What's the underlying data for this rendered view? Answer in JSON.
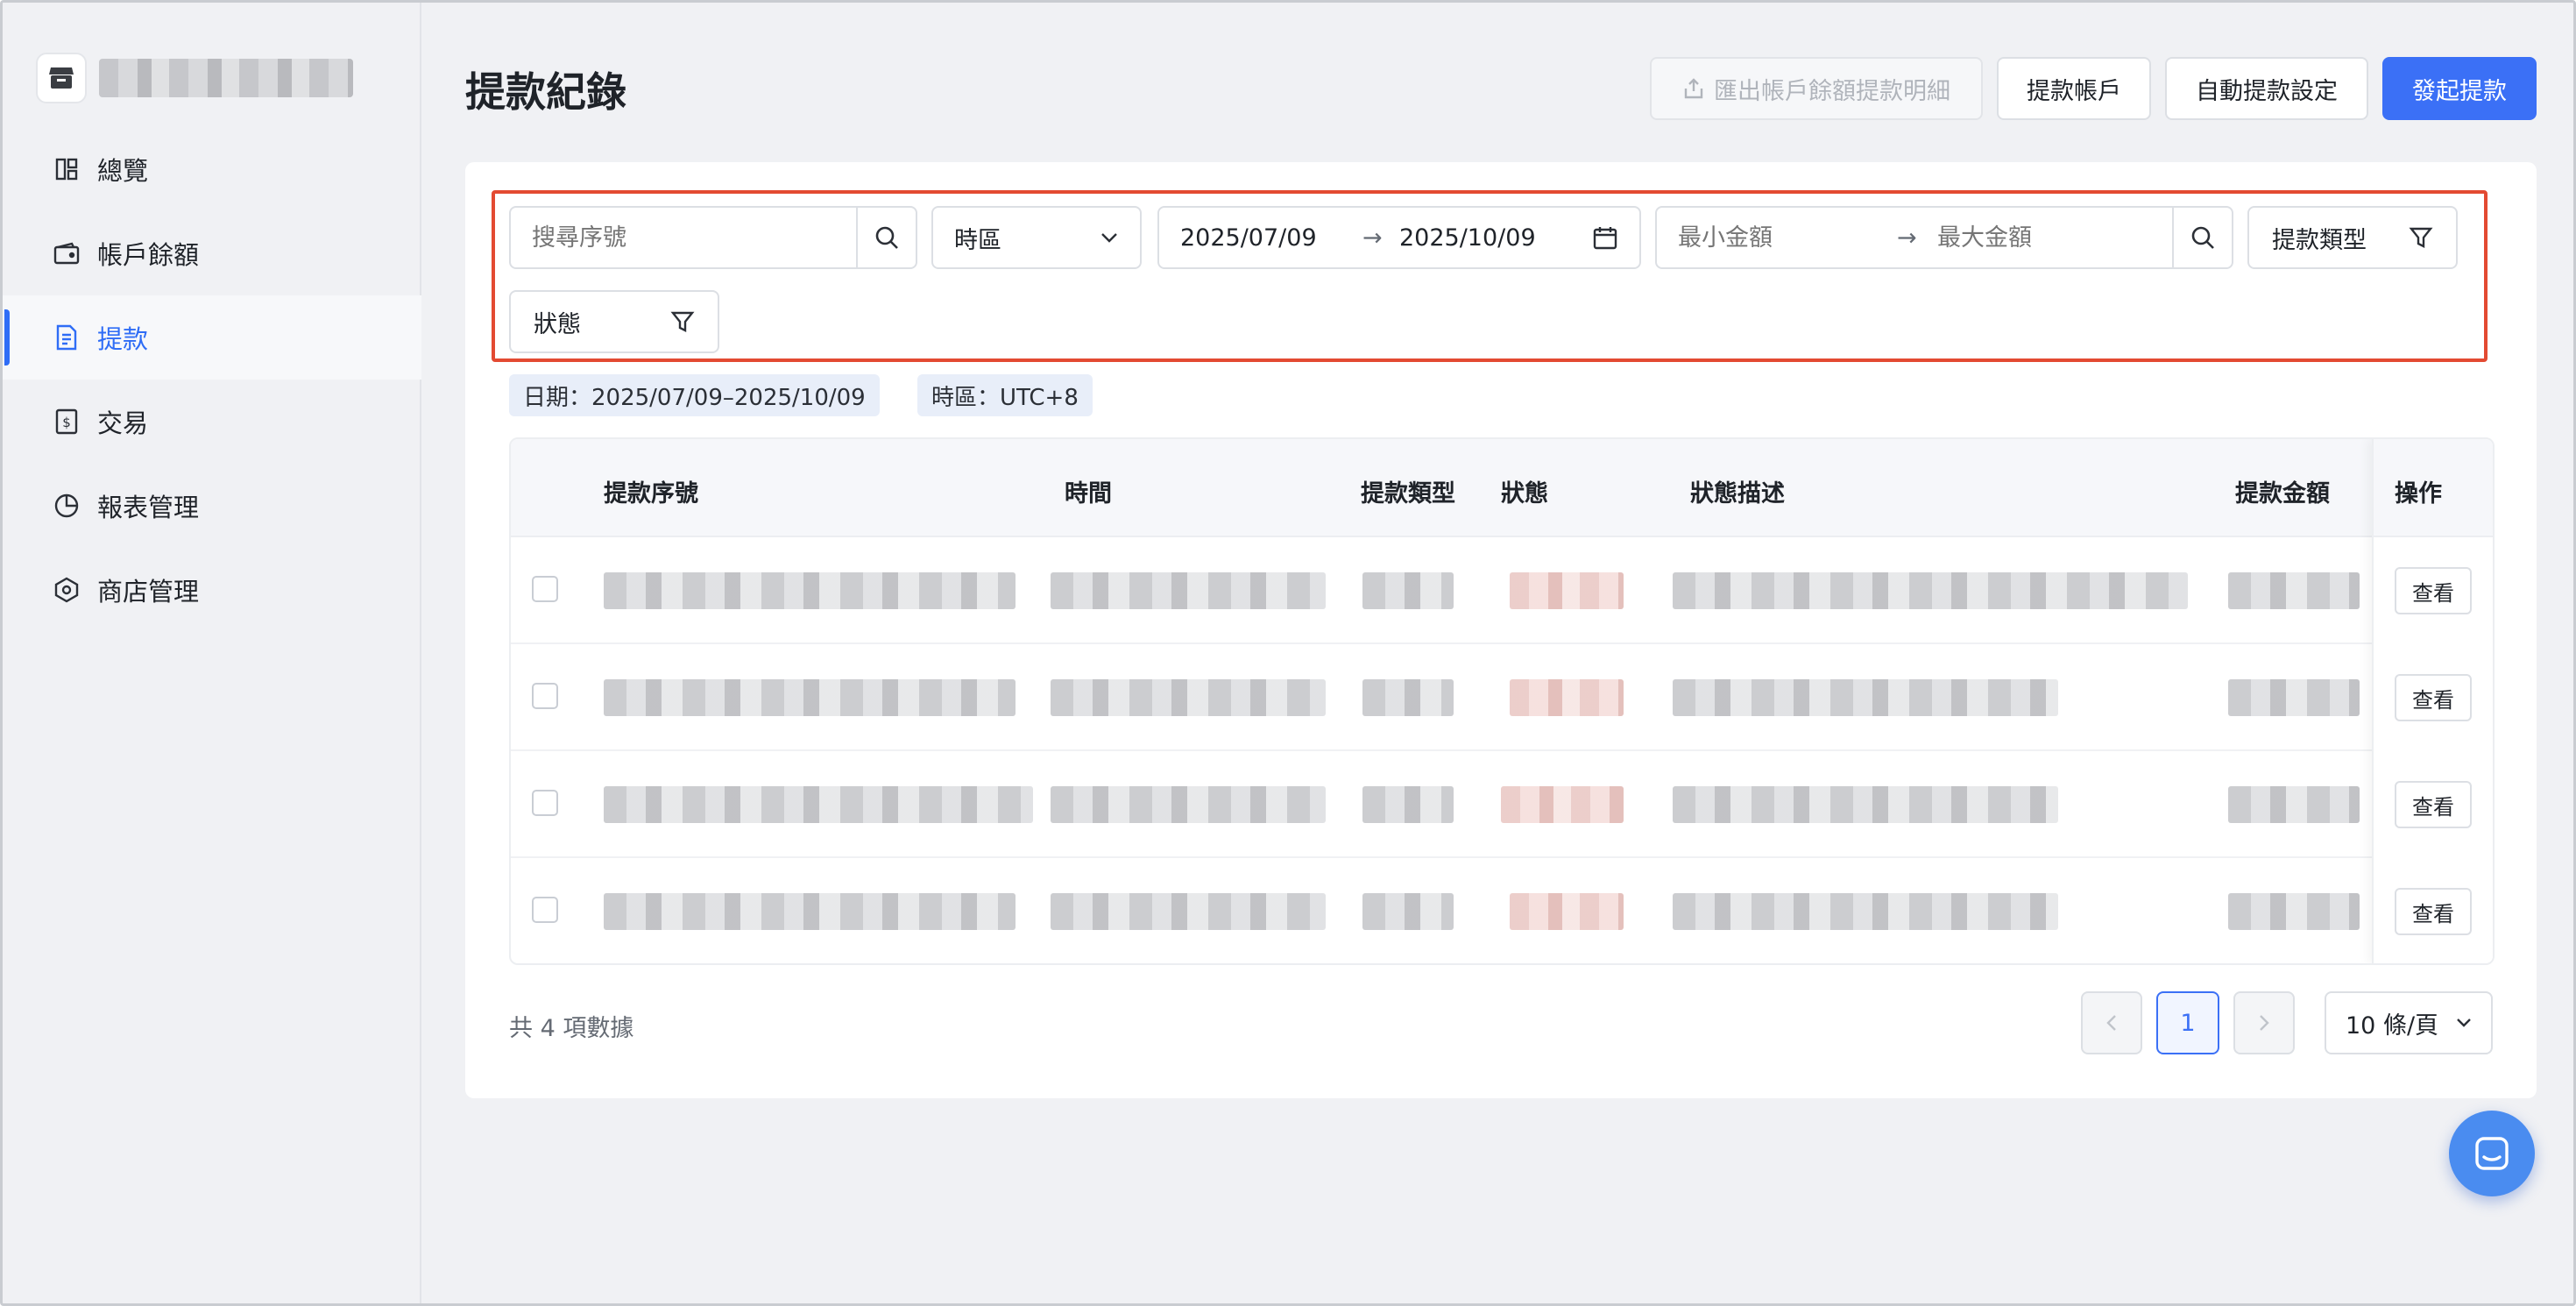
{
  "sidebar": {
    "items": [
      {
        "label": "總覽",
        "icon": "dashboard-icon"
      },
      {
        "label": "帳戶餘額",
        "icon": "wallet-icon"
      },
      {
        "label": "提款",
        "icon": "withdraw-icon",
        "active": true
      },
      {
        "label": "交易",
        "icon": "transaction-icon"
      },
      {
        "label": "報表管理",
        "icon": "report-icon"
      },
      {
        "label": "商店管理",
        "icon": "store-settings-icon"
      }
    ]
  },
  "header": {
    "title": "提款紀錄",
    "export_label": "匯出帳戶餘額提款明細",
    "accounts_label": "提款帳戶",
    "auto_label": "自動提款設定",
    "create_label": "發起提款"
  },
  "filters": {
    "search_placeholder": "搜尋序號",
    "timezone_label": "時區",
    "date_start": "2025/07/09",
    "date_end": "2025/10/09",
    "range_arrow": "→",
    "min_placeholder": "最小金額",
    "max_placeholder": "最大金額",
    "type_label": "提款類型",
    "status_label": "狀態"
  },
  "active_tags": {
    "date": "日期：2025/07/09–2025/10/09",
    "timezone": "時區：UTC+8"
  },
  "table": {
    "columns": {
      "serial": "提款序號",
      "time": "時間",
      "type": "提款類型",
      "status": "狀態",
      "status_desc": "狀態描述",
      "amount": "提款金額",
      "ops": "操作"
    },
    "view_label": "查看",
    "row_count": 4
  },
  "footer": {
    "total": "共 4 項數據",
    "current_page": "1",
    "page_size": "10 條/頁"
  },
  "colors": {
    "primary": "#3b70f6",
    "highlight_border": "#e34a32"
  }
}
